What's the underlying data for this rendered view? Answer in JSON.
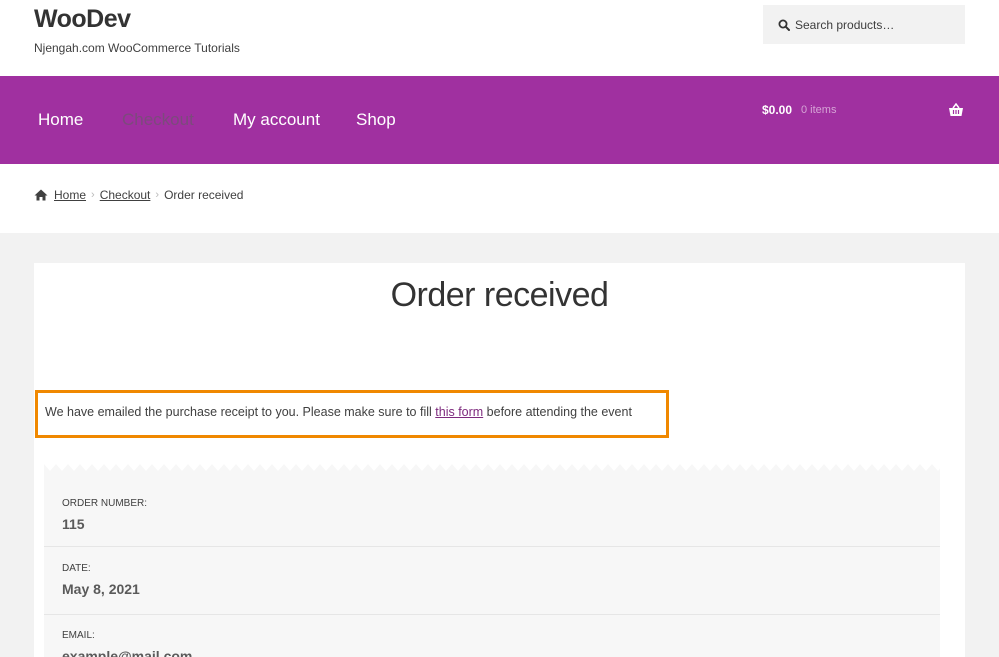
{
  "header": {
    "site_title": "WooDev",
    "tagline": "Njengah.com WooCommerce Tutorials",
    "search_placeholder": "Search products…"
  },
  "nav": {
    "items": [
      {
        "label": "Home",
        "current": false
      },
      {
        "label": "Checkout",
        "current": true
      },
      {
        "label": "My account",
        "current": false
      },
      {
        "label": "Shop",
        "current": false
      }
    ],
    "cart_amount": "$0.00",
    "cart_count": "0 items"
  },
  "breadcrumb": {
    "home": "Home",
    "checkout": "Checkout",
    "current": "Order received"
  },
  "page": {
    "title": "Order received",
    "notice_before": "We have emailed the purchase receipt to you. Please make sure to fill ",
    "notice_link": "this form",
    "notice_after": " before attending the event"
  },
  "order": {
    "number_label": "ORDER NUMBER:",
    "number_value": "115",
    "date_label": "DATE:",
    "date_value": "May 8, 2021",
    "email_label": "EMAIL:",
    "email_value": "example@mail.com"
  },
  "colors": {
    "nav_bg": "#a030a0",
    "notice_border": "#f08800",
    "link": "#7d2a7d"
  }
}
